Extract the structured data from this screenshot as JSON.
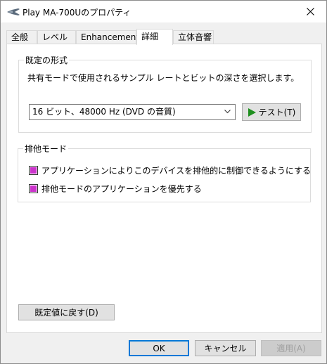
{
  "window": {
    "title": "Play MA-700Uのプロパティ"
  },
  "tabs": [
    {
      "label": "全般"
    },
    {
      "label": "レベル"
    },
    {
      "label": "Enhancements"
    },
    {
      "label": "詳細"
    },
    {
      "label": "立体音響"
    }
  ],
  "default_format": {
    "group_label": "既定の形式",
    "description": "共有モードで使用されるサンプル レートとビットの深さを選択します。",
    "selected": "16 ビット、48000 Hz (DVD の音質)",
    "test_label": "テスト(T)"
  },
  "exclusive_mode": {
    "group_label": "排他モード",
    "options": [
      {
        "label": "アプリケーションによりこのデバイスを排他的に制御できるようにする",
        "checked": true
      },
      {
        "label": "排他モードのアプリケーションを優先する",
        "checked": true
      }
    ]
  },
  "restore_defaults_label": "既定値に戻す(D)",
  "footer": {
    "ok_label": "OK",
    "cancel_label": "キャンセル",
    "apply_label": "適用(A)"
  },
  "colors": {
    "accent": "#0078d7",
    "checkbox_fill": "#cc33cc",
    "play_icon": "#1f8f1f"
  }
}
